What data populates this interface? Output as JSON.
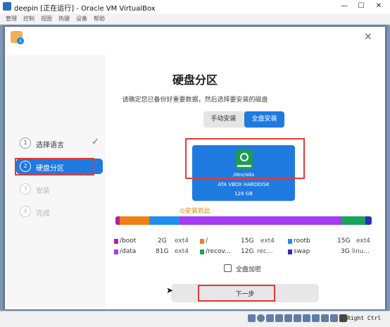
{
  "window": {
    "title": "deepin [正在运行] - Oracle VM VirtualBox",
    "minimize_glyph": "—",
    "maximize_glyph": "☐",
    "close_glyph": "✕"
  },
  "menubar": {
    "items": [
      "管理",
      "控制",
      "视图",
      "热键",
      "设备",
      "帮助"
    ]
  },
  "installer": {
    "close_glyph": "×",
    "steps": [
      {
        "num": "1",
        "label": "选择语言",
        "state": "done"
      },
      {
        "num": "2",
        "label": "硬盘分区",
        "state": "active"
      },
      {
        "num": "3",
        "label": "安装",
        "state": "pending"
      },
      {
        "num": "4",
        "label": "完成",
        "state": "pending"
      }
    ],
    "check_glyph": "✓",
    "heading": "硬盘分区",
    "subtitle": "请确定您已备份好重要数据，然后选择要安装的磁盘",
    "tabs": [
      {
        "label": "手动安装",
        "selected": false
      },
      {
        "label": "全盘安装",
        "selected": true
      }
    ],
    "disk": {
      "path": "/dev/sda",
      "model": "ATA VBOX HARDDISK",
      "size": "128 GB"
    },
    "install_here": "⊙安装到此",
    "partition_colors": [
      "#b51fa8",
      "#f07f13",
      "#1f8ef0",
      "#a33bf2",
      "#16a55a",
      "#2c2cc2"
    ],
    "partition_fractions": [
      0.016,
      0.117,
      0.117,
      0.632,
      0.094,
      0.024
    ],
    "legend": [
      {
        "name": "/boot",
        "size": "2G",
        "fs": "ext4",
        "color": "#b51fa8"
      },
      {
        "name": "/",
        "size": "15G",
        "fs": "ext4",
        "color": "#f07f13"
      },
      {
        "name": "rootb",
        "size": "15G",
        "fs": "ext4",
        "color": "#1f8ef0"
      },
      {
        "name": "/data",
        "size": "81G",
        "fs": "ext4",
        "color": "#a33bf2"
      },
      {
        "name": "/recov...",
        "size": "12G",
        "fs": "rec...",
        "color": "#16a55a"
      },
      {
        "name": "swap",
        "size": "3G",
        "fs": "linu...",
        "color": "#2c2cc2"
      }
    ],
    "encrypt_label": "全盘加密",
    "encrypt_checked": false,
    "next_button": "下一步"
  },
  "statusbar": {
    "host_key": "Right Ctrl"
  },
  "colors": {
    "accent": "#1f7ae0",
    "annotation_red": "#e53935",
    "warning_orange": "#e08a00"
  }
}
